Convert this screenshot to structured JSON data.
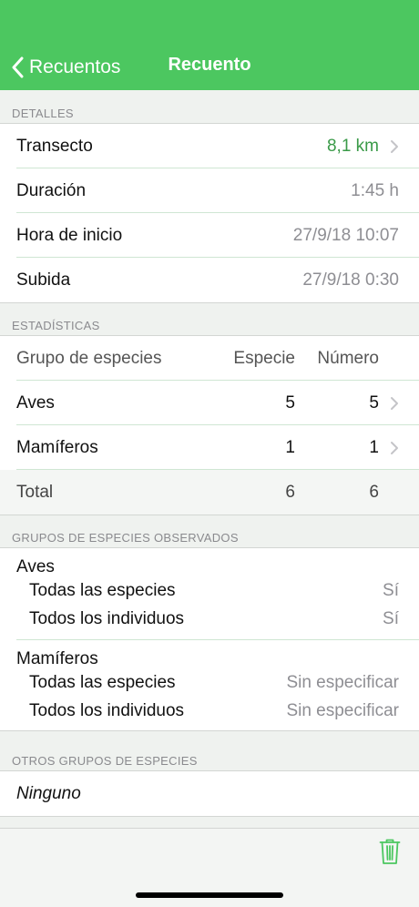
{
  "navbar": {
    "back_label": "Recuentos",
    "title": "Recuento"
  },
  "details": {
    "header": "DETALLES",
    "rows": [
      {
        "label": "Transecto",
        "value": "8,1 km"
      },
      {
        "label": "Duración",
        "value": "1:45 h"
      },
      {
        "label": "Hora de inicio",
        "value": "27/9/18 10:07"
      },
      {
        "label": "Subida",
        "value": "27/9/18 0:30"
      }
    ]
  },
  "stats": {
    "header": "ESTADÍSTICAS",
    "columns": [
      "Grupo de especies",
      "Especie",
      "Número"
    ],
    "rows": [
      {
        "group": "Aves",
        "species": "5",
        "number": "5"
      },
      {
        "group": "Mamíferos",
        "species": "1",
        "number": "1"
      }
    ],
    "total": {
      "label": "Total",
      "species": "6",
      "number": "6"
    }
  },
  "observed": {
    "header": "GRUPOS DE ESPECIES OBSERVADOS",
    "groups": [
      {
        "name": "Aves",
        "items": [
          {
            "label": "Todas las especies",
            "value": "Sí"
          },
          {
            "label": "Todos los individuos",
            "value": "Sí"
          }
        ]
      },
      {
        "name": "Mamíferos",
        "items": [
          {
            "label": "Todas las especies",
            "value": "Sin especificar"
          },
          {
            "label": "Todos los individuos",
            "value": "Sin especificar"
          }
        ]
      }
    ]
  },
  "other": {
    "header": "OTROS GRUPOS DE ESPECIES",
    "value": "Ninguno"
  },
  "toolbar": {
    "trash_icon": "trash-icon"
  },
  "colors": {
    "accent": "#4cc760",
    "value_green": "#3a9a48"
  }
}
